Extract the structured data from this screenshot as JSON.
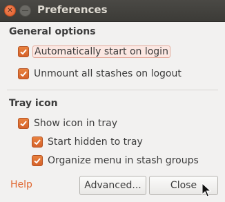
{
  "window": {
    "title": "Preferences"
  },
  "general": {
    "title": "General options",
    "items": [
      {
        "label": "Automatically start on login",
        "checked": true,
        "focused": true
      },
      {
        "label": "Unmount all stashes on logout",
        "checked": true
      }
    ]
  },
  "tray": {
    "title": "Tray icon",
    "items": [
      {
        "label": "Show icon in tray",
        "checked": true
      },
      {
        "label": "Start hidden to tray",
        "checked": true
      },
      {
        "label": "Organize menu in stash groups",
        "checked": true
      }
    ]
  },
  "footer": {
    "help_label": "Help",
    "advanced_label": "Advanced...",
    "close_label": "Close"
  },
  "colors": {
    "accent": "#dd4814",
    "checkbox": "#e0662f",
    "titlebar": "#3c3b37"
  },
  "icons": [
    "close-icon",
    "minimize-icon",
    "checkmark-icon",
    "mouse-cursor-icon"
  ]
}
